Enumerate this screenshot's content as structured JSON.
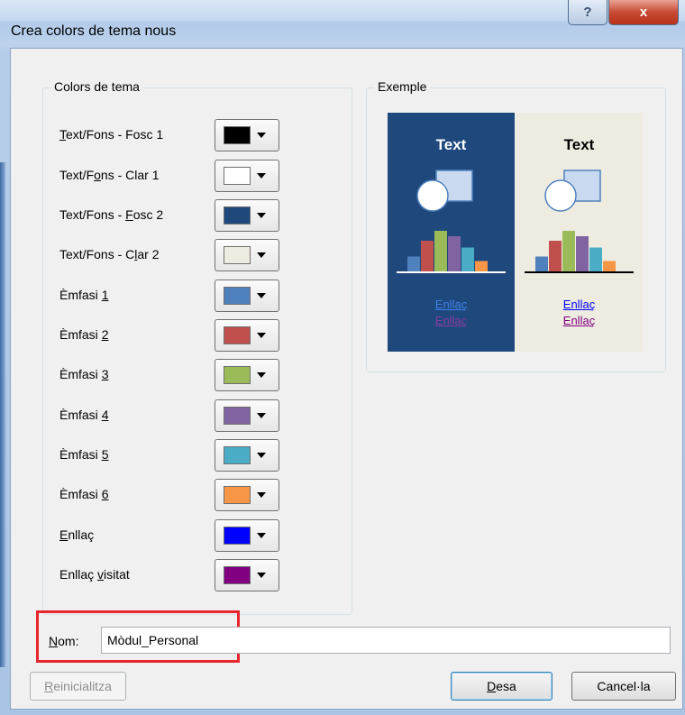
{
  "window": {
    "title": "Crea colors de tema nous",
    "help_label": "?",
    "close_label": "x"
  },
  "theme_colors": {
    "group_title": "Colors de tema",
    "rows": [
      {
        "label": "Text/Fons - Fosc 1",
        "key": "T",
        "rest": "ext/Fons - Fosc 1",
        "color": "#000000"
      },
      {
        "label": "Text/Fons - Clar 1",
        "key": "o",
        "pre": "Text/F",
        "rest": "ns - Clar 1",
        "color": "#ffffff"
      },
      {
        "label": "Text/Fons - Fosc 2",
        "key": "F",
        "pre": "Text/Fons - ",
        "rest": "osc 2",
        "color": "#1f497d"
      },
      {
        "label": "Text/Fons - Clar 2",
        "key": "l",
        "pre": "Text/Fons - C",
        "rest": "ar 2",
        "color": "#eeece1"
      },
      {
        "label": "Èmfasi 1",
        "key": "1",
        "pre": "Èmfasi ",
        "rest": "",
        "color": "#4f81bd"
      },
      {
        "label": "Èmfasi 2",
        "key": "2",
        "pre": "Èmfasi ",
        "rest": "",
        "color": "#c0504d"
      },
      {
        "label": "Èmfasi 3",
        "key": "3",
        "pre": "Èmfasi ",
        "rest": "",
        "color": "#9bbb59"
      },
      {
        "label": "Èmfasi 4",
        "key": "4",
        "pre": "Èmfasi ",
        "rest": "",
        "color": "#8064a2"
      },
      {
        "label": "Èmfasi 5",
        "key": "5",
        "pre": "Èmfasi ",
        "rest": "",
        "color": "#4bacc6"
      },
      {
        "label": "Èmfasi 6",
        "key": "6",
        "pre": "Èmfasi ",
        "rest": "",
        "color": "#f79646"
      },
      {
        "label": "Enllaç",
        "key": "E",
        "pre": "",
        "rest": "nllaç",
        "color": "#0000ff"
      },
      {
        "label": "Enllaç visitat",
        "key": "v",
        "pre": "Enllaç ",
        "rest": "isitat",
        "color": "#800080"
      }
    ]
  },
  "example": {
    "group_title": "Exemple",
    "dark_text": "Text",
    "light_text": "Text",
    "link": "Enllaç",
    "visited_link": "Enllaç",
    "dark_bg": "#1f497d",
    "light_bg": "#eeece1",
    "bar_colors": [
      "#4f81bd",
      "#c0504d",
      "#9bbb59",
      "#8064a2",
      "#4bacc6",
      "#f79646"
    ],
    "bar_heights": [
      0.35,
      0.7,
      0.92,
      0.8,
      0.55,
      0.25
    ]
  },
  "name": {
    "label": "Nom:",
    "value": "Mòdul_Personal"
  },
  "buttons": {
    "reset": "Reinicialitza",
    "save": "Desa",
    "cancel": "Cancel·la"
  }
}
